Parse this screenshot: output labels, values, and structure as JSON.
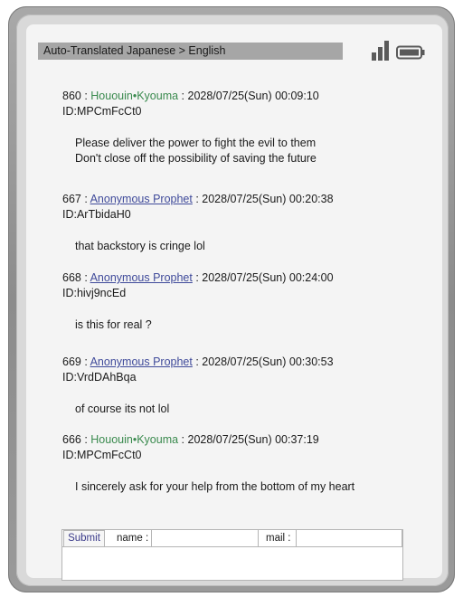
{
  "header": {
    "title": "Auto-Translated  Japanese > English"
  },
  "icons": {
    "signal": "signal-bars-icon",
    "battery": "battery-icon"
  },
  "posts": [
    {
      "num": "860",
      "name": "Hououin•Kyouma",
      "date": "2028/07/25(Sun) 00:09:10",
      "id": "ID:MPCmFcCt0",
      "lines": [
        "Please deliver the power to fight the evil to them",
        "Don't close off the possibility of saving the future"
      ]
    },
    {
      "num": "667",
      "name": "Anonymous Prophet",
      "date": "2028/07/25(Sun) 00:20:38",
      "id": "ID:ArTbidaH0",
      "lines": [
        "that backstory is cringe lol"
      ]
    },
    {
      "num": "668",
      "name": "Anonymous Prophet",
      "date": "2028/07/25(Sun) 00:24:00",
      "id": "ID:hivj9ncEd",
      "lines": [
        "is this for real ?"
      ]
    },
    {
      "num": "669",
      "name": "Anonymous Prophet",
      "date": "2028/07/25(Sun) 00:30:53",
      "id": "ID:VrdDAhBqa",
      "lines": [
        "of course its not lol"
      ]
    },
    {
      "num": "666",
      "name": "Hououin•Kyouma",
      "date": "2028/07/25(Sun) 00:37:19",
      "id": "ID:MPCmFcCt0",
      "lines": [
        "I sincerely ask for your help from the bottom of my heart"
      ]
    }
  ],
  "form": {
    "submit_label": "Submit",
    "name_label": "name :",
    "name_value": "",
    "mail_label": "mail :",
    "mail_value": ""
  },
  "colors": {
    "trip_green": "#3a8a4e",
    "anon_blue": "#3f4a9a",
    "statusbar": "#a6a6a6"
  }
}
